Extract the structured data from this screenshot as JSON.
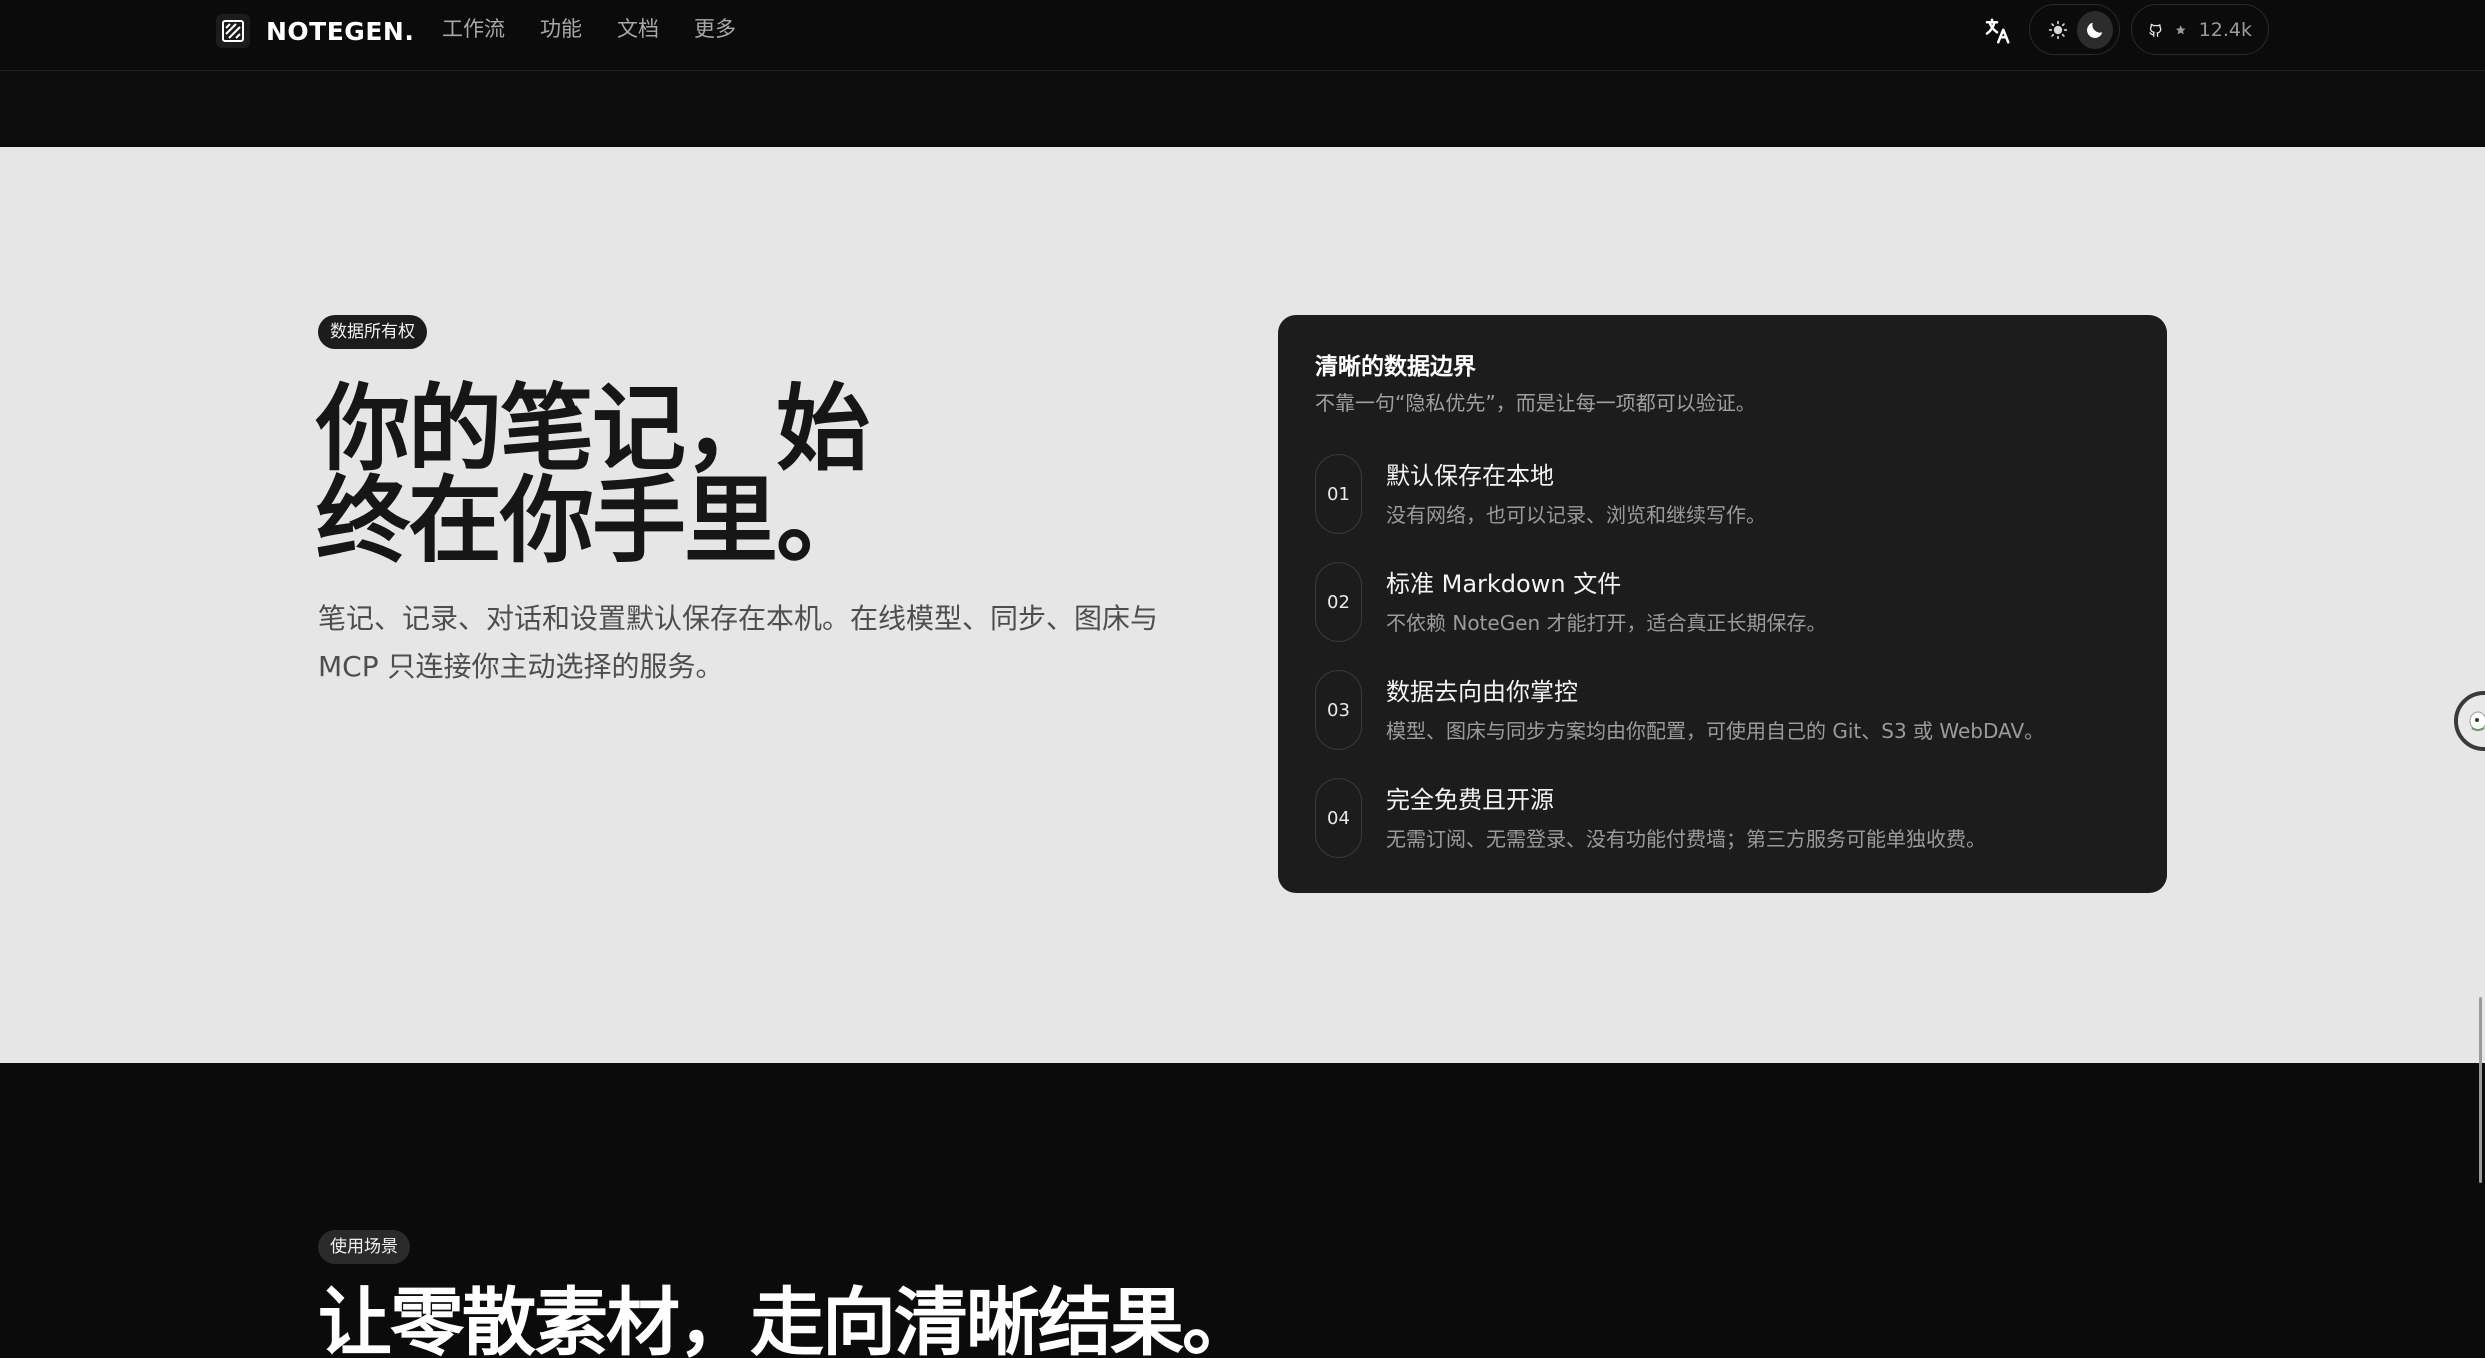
{
  "header": {
    "brand": "NOTEGEN.",
    "nav": [
      "工作流",
      "功能",
      "文档",
      "更多"
    ],
    "github_stars": "12.4k",
    "icons": {
      "logo": "notegen-logo-icon",
      "translate": "translate-icon",
      "light": "sun-icon",
      "dark": "moon-icon",
      "github": "github-icon",
      "star": "star-icon"
    }
  },
  "ownership": {
    "badge": "数据所有权",
    "title_line1": "你的笔记，始",
    "title_line2": "终在你手里。",
    "description": "笔记、记录、对话和设置默认保存在本机。在线模型、同步、图床与 MCP 只连接你主动选择的服务。",
    "card": {
      "title": "清晰的数据边界",
      "subtitle": "不靠一句“隐私优先”，而是让每一项都可以验证。",
      "items": [
        {
          "num": "01",
          "title": "默认保存在本地",
          "desc": "没有网络，也可以记录、浏览和继续写作。"
        },
        {
          "num": "02",
          "title": "标准 Markdown 文件",
          "desc": "不依赖 NoteGen 才能打开，适合真正长期保存。"
        },
        {
          "num": "03",
          "title": "数据去向由你掌控",
          "desc": "模型、图床与同步方案均由你配置，可使用自己的 Git、S3 或 WebDAV。"
        },
        {
          "num": "04",
          "title": "完全免费且开源",
          "desc": "无需订阅、无需登录、没有功能付费墙；第三方服务可能单独收费。"
        }
      ]
    }
  },
  "scenarios": {
    "badge": "使用场景",
    "title": "让零散素材，走向清晰结果。"
  }
}
